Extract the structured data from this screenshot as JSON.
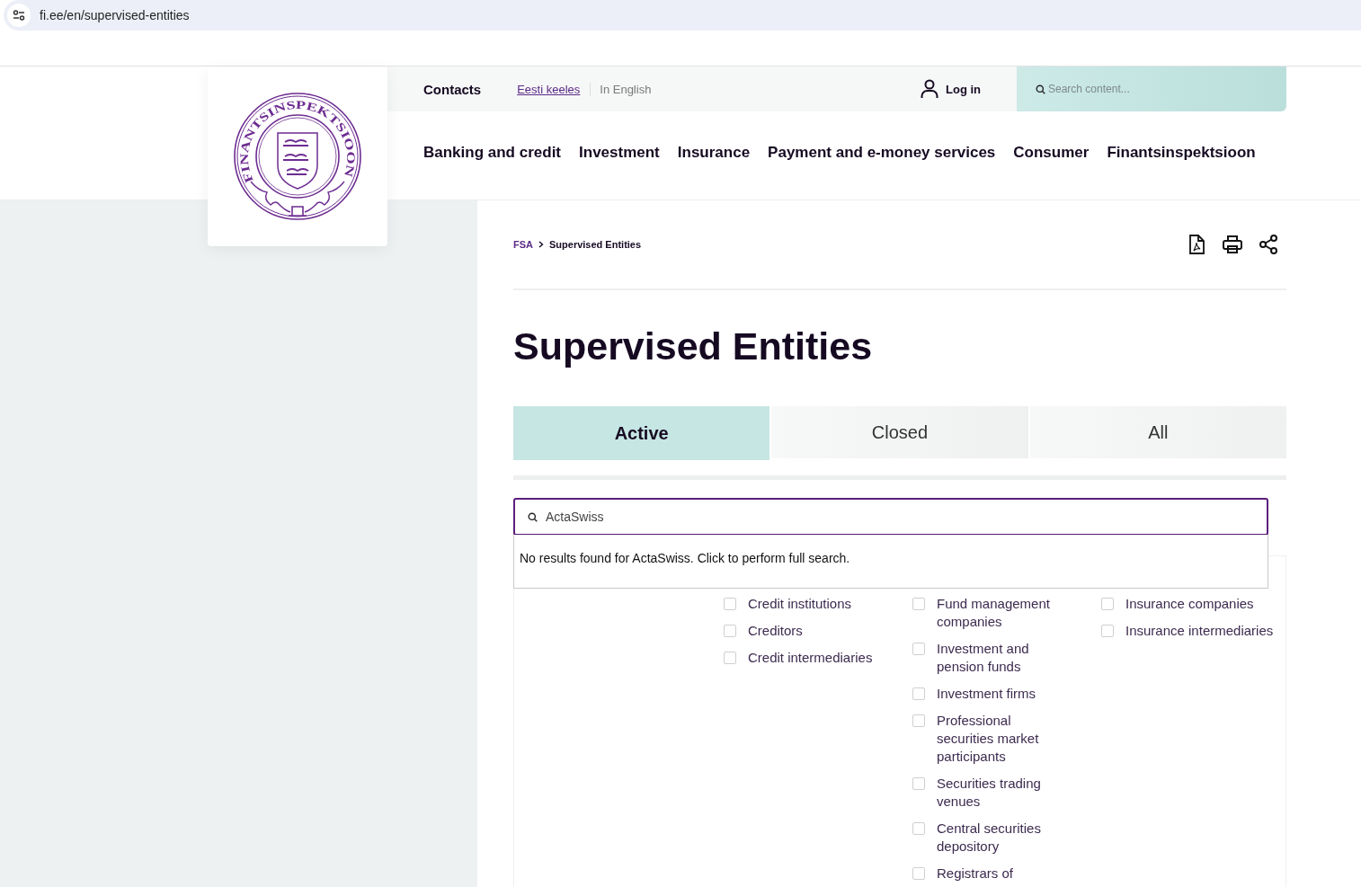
{
  "address_bar": {
    "url": "fi.ee/en/supervised-entities"
  },
  "logo": {
    "text": "FINANTSINSPEKTSIOON"
  },
  "top_bar": {
    "contacts": "Contacts",
    "languages": [
      {
        "label": "Eesti keeles",
        "selected": false
      },
      {
        "label": "In English",
        "selected": true
      }
    ],
    "login": "Log in",
    "search": {
      "placeholder": "Search content..."
    }
  },
  "nav": [
    "Banking and credit",
    "Investment",
    "Insurance",
    "Payment and e-money services",
    "Consumer",
    "Finantsinspektsioon"
  ],
  "breadcrumb": [
    "FSA",
    "Supervised Entities"
  ],
  "title": "Supervised Entities",
  "tabs": [
    {
      "label": "Active",
      "selected": true
    },
    {
      "label": "Closed",
      "selected": false
    },
    {
      "label": "All",
      "selected": false
    }
  ],
  "filter_search": {
    "value": "ActaSwiss",
    "message": "No results found for ActaSwiss. Click to perform full search."
  },
  "filters": [
    {
      "items": [
        {
          "label": "Credit institutions",
          "checked": false
        },
        {
          "label": "Creditors",
          "checked": false
        },
        {
          "label": "Credit intermediaries",
          "checked": false
        }
      ]
    },
    {
      "items": [
        {
          "label": "Fund management companies",
          "checked": false
        },
        {
          "label": "Investment and pension funds",
          "checked": false
        },
        {
          "label": "Investment firms",
          "checked": false
        },
        {
          "label": "Professional securities market participants",
          "checked": false
        },
        {
          "label": "Securities trading venues",
          "checked": false
        },
        {
          "label": "Central securities depository",
          "checked": false
        },
        {
          "label": "Registrars of",
          "checked": false
        }
      ]
    },
    {
      "items": [
        {
          "label": "Insurance companies",
          "checked": false
        },
        {
          "label": "Insurance intermediaries",
          "checked": false
        }
      ]
    }
  ]
}
